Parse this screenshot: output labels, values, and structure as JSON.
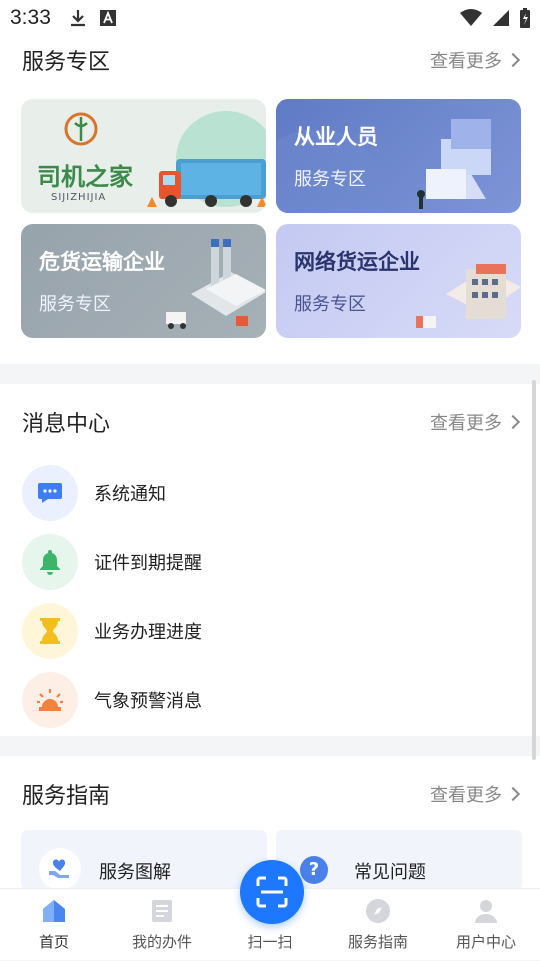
{
  "status_bar": {
    "time": "3:33"
  },
  "service_zone": {
    "title": "服务专区",
    "more": "查看更多",
    "cards": [
      {
        "title": "司机之家",
        "subtitle": "SIJIZHIJIA",
        "color": "#e9efe9"
      },
      {
        "title": "从业人员",
        "subtitle": "服务专区",
        "color": "#6a84c8"
      },
      {
        "title": "危货运输企业",
        "subtitle": "服务专区",
        "color": "#9aa5ad"
      },
      {
        "title": "网络货运企业",
        "subtitle": "服务专区",
        "color": "#c9cef4"
      }
    ]
  },
  "message_center": {
    "title": "消息中心",
    "more": "查看更多",
    "items": [
      {
        "label": "系统通知",
        "icon": "chat-bubble-icon",
        "bg": "#eaf0fd",
        "fg": "#3d7ef5"
      },
      {
        "label": "证件到期提醒",
        "icon": "bell-icon",
        "bg": "#e6f6ec",
        "fg": "#3cb56a"
      },
      {
        "label": "业务办理进度",
        "icon": "hourglass-icon",
        "bg": "#fff6d9",
        "fg": "#f2bd1d"
      },
      {
        "label": "气象预警消息",
        "icon": "alarm-light-icon",
        "bg": "#fdeee6",
        "fg": "#f5813f"
      }
    ]
  },
  "service_guide": {
    "title": "服务指南",
    "more": "查看更多",
    "cards": [
      {
        "label": "服务图解",
        "icon": "heart-hand-icon"
      },
      {
        "label": "常见问题",
        "icon": "question-icon"
      }
    ]
  },
  "tabbar": {
    "items": [
      {
        "label": "首页",
        "icon": "home-icon",
        "active": true
      },
      {
        "label": "我的办件",
        "icon": "document-icon"
      },
      {
        "label": "扫一扫",
        "icon": "scan-icon"
      },
      {
        "label": "服务指南",
        "icon": "compass-icon"
      },
      {
        "label": "用户中心",
        "icon": "user-icon"
      }
    ]
  }
}
